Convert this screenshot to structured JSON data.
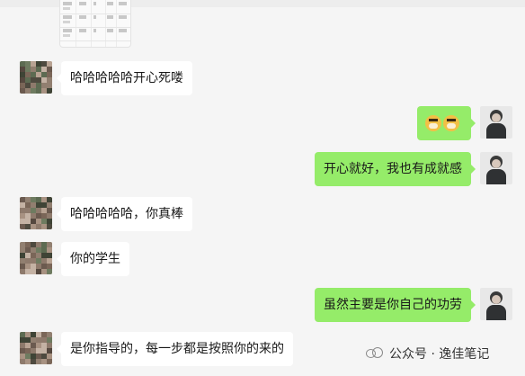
{
  "thumbnail": {
    "label": "shared table image"
  },
  "messages": [
    {
      "side": "in",
      "text": "哈哈哈哈哈开心死喽"
    },
    {
      "side": "out",
      "text": "",
      "emoji": [
        "doge-icon",
        "doge-icon"
      ]
    },
    {
      "side": "out",
      "text": "开心就好，我也有成就感"
    },
    {
      "side": "in",
      "text": "哈哈哈哈哈，你真棒"
    },
    {
      "side": "in",
      "text": "你的学生"
    },
    {
      "side": "out",
      "text": "虽然主要是你自己的功劳"
    },
    {
      "side": "in",
      "text": "是你指导的，每一步都是按照你的来的"
    }
  ],
  "watermark": {
    "text": "公众号 · 逸佳笔记",
    "icon": "wechat-official-account-icon"
  },
  "colors": {
    "background": "#f5f5f5",
    "incoming_bubble": "#ffffff",
    "outgoing_bubble": "#95ec69"
  }
}
